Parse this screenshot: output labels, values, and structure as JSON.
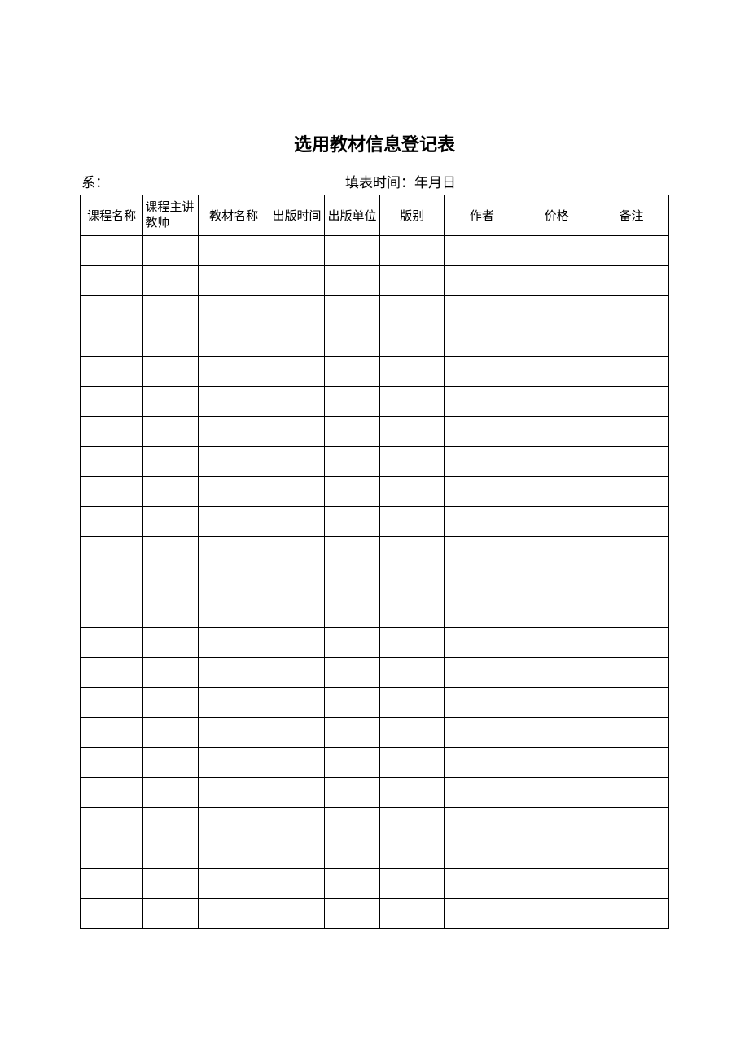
{
  "title": "选用教材信息登记表",
  "meta": {
    "department_label": "系：",
    "fill_time_label": "填表时间：年月日"
  },
  "headers": [
    "课程名称",
    "课程主讲教师",
    "教材名称",
    "出版时间",
    "出版单位",
    "版别",
    "作者",
    "价格",
    "备注"
  ],
  "rows": [
    [
      "",
      "",
      "",
      "",
      "",
      "",
      "",
      "",
      ""
    ],
    [
      "",
      "",
      "",
      "",
      "",
      "",
      "",
      "",
      ""
    ],
    [
      "",
      "",
      "",
      "",
      "",
      "",
      "",
      "",
      ""
    ],
    [
      "",
      "",
      "",
      "",
      "",
      "",
      "",
      "",
      ""
    ],
    [
      "",
      "",
      "",
      "",
      "",
      "",
      "",
      "",
      ""
    ],
    [
      "",
      "",
      "",
      "",
      "",
      "",
      "",
      "",
      ""
    ],
    [
      "",
      "",
      "",
      "",
      "",
      "",
      "",
      "",
      ""
    ],
    [
      "",
      "",
      "",
      "",
      "",
      "",
      "",
      "",
      ""
    ],
    [
      "",
      "",
      "",
      "",
      "",
      "",
      "",
      "",
      ""
    ],
    [
      "",
      "",
      "",
      "",
      "",
      "",
      "",
      "",
      ""
    ],
    [
      "",
      "",
      "",
      "",
      "",
      "",
      "",
      "",
      ""
    ],
    [
      "",
      "",
      "",
      "",
      "",
      "",
      "",
      "",
      ""
    ],
    [
      "",
      "",
      "",
      "",
      "",
      "",
      "",
      "",
      ""
    ],
    [
      "",
      "",
      "",
      "",
      "",
      "",
      "",
      "",
      ""
    ],
    [
      "",
      "",
      "",
      "",
      "",
      "",
      "",
      "",
      ""
    ],
    [
      "",
      "",
      "",
      "",
      "",
      "",
      "",
      "",
      ""
    ],
    [
      "",
      "",
      "",
      "",
      "",
      "",
      "",
      "",
      ""
    ],
    [
      "",
      "",
      "",
      "",
      "",
      "",
      "",
      "",
      ""
    ],
    [
      "",
      "",
      "",
      "",
      "",
      "",
      "",
      "",
      ""
    ],
    [
      "",
      "",
      "",
      "",
      "",
      "",
      "",
      "",
      ""
    ],
    [
      "",
      "",
      "",
      "",
      "",
      "",
      "",
      "",
      ""
    ],
    [
      "",
      "",
      "",
      "",
      "",
      "",
      "",
      "",
      ""
    ],
    [
      "",
      "",
      "",
      "",
      "",
      "",
      "",
      "",
      ""
    ]
  ]
}
